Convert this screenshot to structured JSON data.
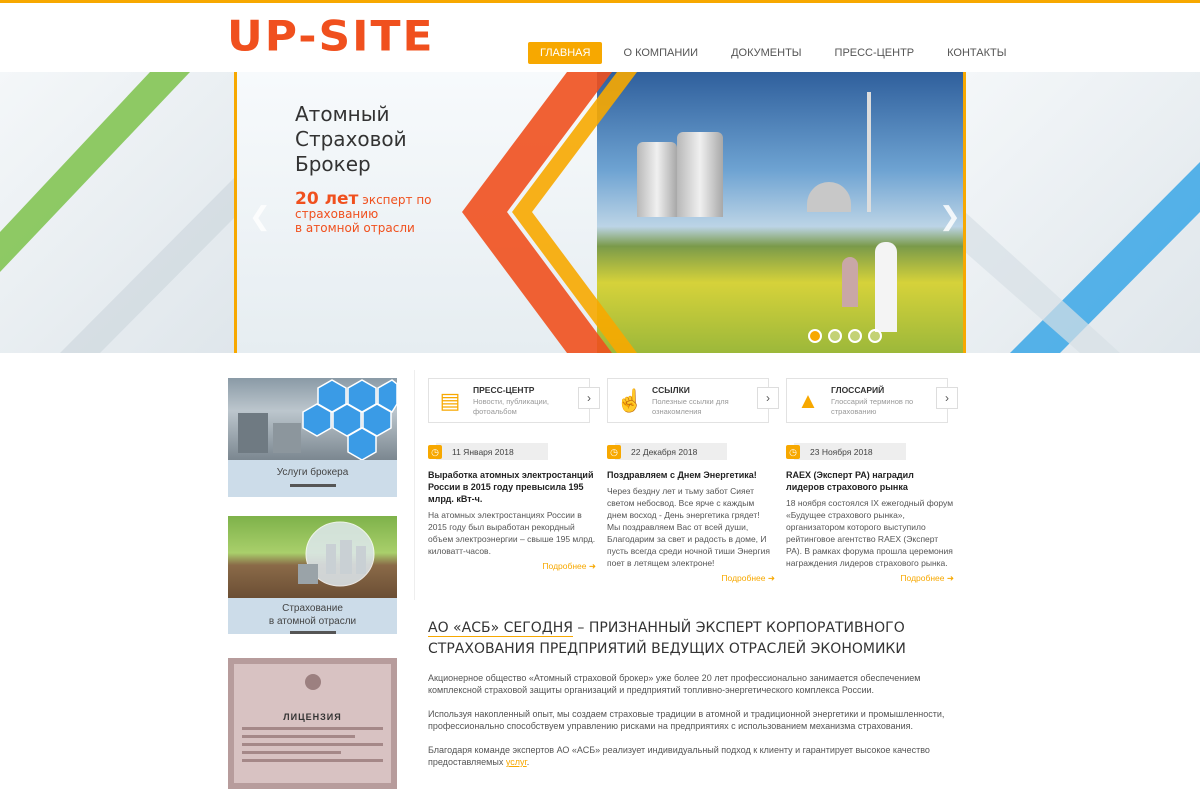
{
  "logo": "UP-SITE",
  "nav": [
    "ГЛАВНАЯ",
    "О КОМПАНИИ",
    "ДОКУМЕНТЫ",
    "ПРЕСС-ЦЕНТР",
    "КОНТАКТЫ"
  ],
  "colors": {
    "accent": "#f7a800",
    "brand": "#f0501e"
  },
  "slider": {
    "title_1": "Атомный",
    "title_2": "Страховой",
    "title_3": "Брокер",
    "years": "20 лет",
    "sub_1": "эксперт по страхованию",
    "sub_2": "в атомной отрасли",
    "slide_count": 4,
    "active_slide": 1
  },
  "sidebar": {
    "card1": "Услуги брокера",
    "card2_l1": "Страхование",
    "card2_l2": "в атомной отрасли",
    "license": "ЛИЦЕНЗИЯ"
  },
  "cards": [
    {
      "title": "ПРЕСС-ЦЕНТР",
      "desc": "Новости, публикации, фотоальбом",
      "icon": "document-icon"
    },
    {
      "title": "ССЫЛКИ",
      "desc": "Полезные ссылки для ознакомления",
      "icon": "pointer-hand-icon"
    },
    {
      "title": "ГЛОССАРИЙ",
      "desc": "Глоссарий терминов по страхованию",
      "icon": "graduation-cap-icon"
    }
  ],
  "news": [
    {
      "date": "11 Января 2018",
      "head": "Выработка атомных электростанций России в 2015 году превысила 195 млрд. кВт-ч.",
      "body": "На атомных электростанциях России в 2015 году был выработан рекордный объем электроэнергии – свыше 195 млрд. киловатт-часов.",
      "more": "Подробнее"
    },
    {
      "date": "22 Декабря 2018",
      "head": "Поздравляем с Днем Энергетика!",
      "body": "Через бездну лет и тьму забот Сияет светом небосвод. Все ярче с каждым днем восход - День энергетика грядет! Мы поздравляем Вас от всей души, Благодарим за свет и радость в доме, И пусть всегда среди ночной тиши Энергия поет в летящем электроне!",
      "more": "Подробнее"
    },
    {
      "date": "23 Ноября 2018",
      "head": "RAEX (Эксперт РА) наградил лидеров страхового рынка",
      "body": "18 ноября состоялся IX ежегодный форум «Будущее страхового рынка», организатором которого выступило рейтинговое агентство RAEX (Эксперт РА). В рамках форума прошла церемония награждения лидеров страхового рынка.",
      "more": "Подробнее"
    }
  ],
  "section": {
    "title_part1": "АО «АСБ» сегодня",
    "title_part2": " – признанный эксперт корпоративного страхования предприятий ведущих отраслей экономики",
    "p1": "Акционерное общество «Атомный страховой брокер» уже более 20 лет профессионально занимается обеспечением комплексной страховой защиты организаций и предприятий топливно-энергетического комплекса России.",
    "p2": "Используя накопленный опыт, мы создаем страховые традиции в атомной и традиционной энергетики и промышленности, профессионально способствуем управлению рисками на предприятиях с использованием механизма страхования.",
    "p3": "Благодаря команде  экспертов АО «АСБ» реализует индивидуальный подход к  клиенту и гарантирует высокое качество предоставляемых ",
    "p3_link": "услуг",
    "p3_end": "."
  }
}
